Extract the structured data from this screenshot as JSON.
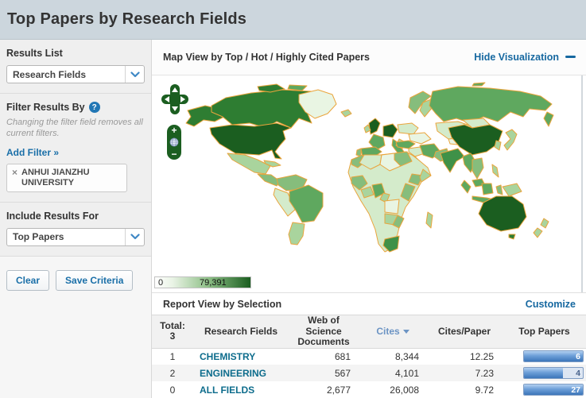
{
  "page": {
    "title": "Top Papers by Research Fields"
  },
  "sidebar": {
    "results_list": {
      "label": "Results List",
      "selected": "Research Fields"
    },
    "filter": {
      "label": "Filter Results By",
      "help_icon": "?",
      "note": "Changing the filter field removes all current filters.",
      "add_filter": "Add Filter »",
      "tag": {
        "remove": "×",
        "label": "ANHUI JIANZHU UNIVERSITY"
      }
    },
    "include": {
      "label": "Include Results For",
      "selected": "Top Papers"
    },
    "buttons": {
      "clear": "Clear",
      "save": "Save Criteria"
    }
  },
  "map": {
    "title": "Map View by Top / Hot / Highly Cited Papers",
    "hide_link": "Hide Visualization",
    "controls": {
      "zoom_in": "+",
      "zoom_out": "−"
    },
    "legend": {
      "min": "0",
      "max": "79,391"
    },
    "palette": {
      "border": "#eaa43c",
      "vdark": "#1b5e20",
      "dark": "#2e7d32",
      "mdark": "#3f9148",
      "medium": "#5fa85f",
      "mlight": "#86bd7c",
      "light": "#a9d49d",
      "pale": "#d4ebcb",
      "xpale": "#e9f5e3"
    },
    "control_green": "#1b5e20"
  },
  "report": {
    "title": "Report View by Selection",
    "customize": "Customize",
    "total_label": "Total:",
    "total_value": "3",
    "columns": [
      "Research Fields",
      "Web of Science Documents",
      "Cites",
      "Cites/Paper",
      "Top Papers"
    ],
    "rows": [
      {
        "rank": "1",
        "field": "CHEMISTRY",
        "docs": "681",
        "cites": "8,344",
        "cites_per_paper": "12.25",
        "top_papers": "6",
        "bar_pct": 100
      },
      {
        "rank": "2",
        "field": "ENGINEERING",
        "docs": "567",
        "cites": "4,101",
        "cites_per_paper": "7.23",
        "top_papers": "4",
        "bar_pct": 66
      },
      {
        "rank": "0",
        "field": "ALL FIELDS",
        "docs": "2,677",
        "cites": "26,008",
        "cites_per_paper": "9.72",
        "top_papers": "27",
        "bar_pct": 100
      }
    ]
  },
  "colors": {
    "header_bg": "#ccd6dd",
    "link_blue": "#1668a0",
    "field_link": "#0d6c8c",
    "sorted_col": "#6c94c4",
    "bar_fill": "#3c76ba",
    "bar_track": "#dde6f2"
  }
}
